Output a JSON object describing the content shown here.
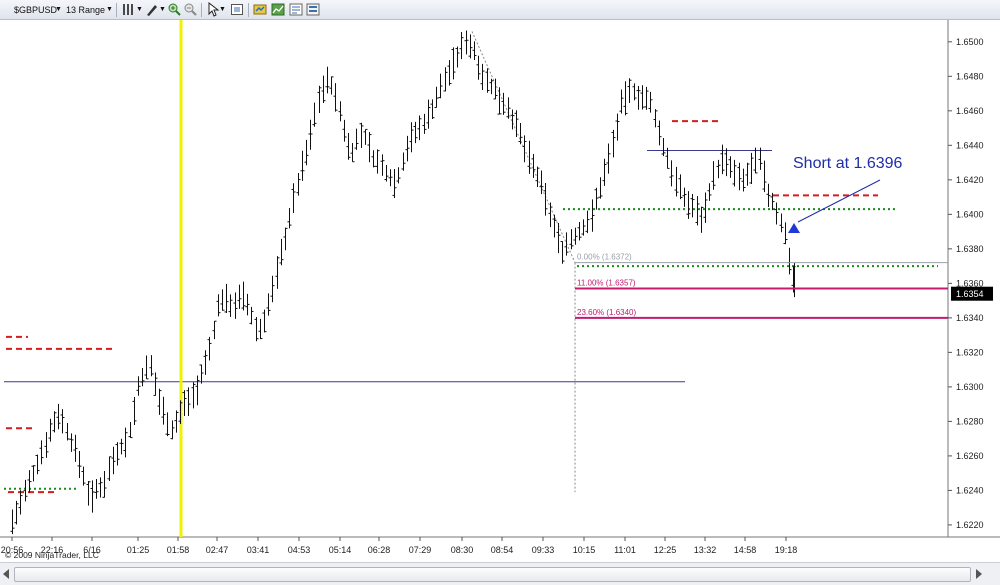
{
  "toolbar": {
    "instrument": "$GBPUSD",
    "period": "13 Range"
  },
  "copyright": "© 2009 NinjaTrader, LLC",
  "chart_data": {
    "type": "candlestick",
    "price_axis": {
      "ticks": [
        "1.6500",
        "1.6480",
        "1.6460",
        "1.6440",
        "1.6420",
        "1.6400",
        "1.6380",
        "1.6360",
        "1.6340",
        "1.6320",
        "1.6300",
        "1.6280",
        "1.6260",
        "1.6240",
        "1.6220"
      ],
      "min": 1.6213,
      "max": 1.6508,
      "current_price": "1.6354"
    },
    "time_axis": {
      "labels": [
        "20:56",
        "22:16",
        "6/16",
        "01:25",
        "01:58",
        "02:47",
        "03:41",
        "04:53",
        "05:14",
        "06:28",
        "07:29",
        "08:30",
        "08:54",
        "09:33",
        "10:15",
        "11:01",
        "12:25",
        "13:32",
        "14:58",
        "19:18"
      ]
    },
    "fib_levels": [
      {
        "label": "0.00% (1.6372)",
        "price": 1.6372,
        "color": "#9aa0a6"
      },
      {
        "label": "11.00% (1.6357)",
        "price": 1.6357,
        "color": "#c21b6f"
      },
      {
        "label": "23.60% (1.6340)",
        "price": 1.634,
        "color": "#c21b6f"
      }
    ],
    "annotation": {
      "text": "Short at 1.6396",
      "color": "#1f2ea8"
    },
    "colors": {
      "bars": "#111111",
      "vline": "#f2f200",
      "red_levels": "#d21e1e",
      "green_levels": "#1a8a1a",
      "blue_lines": "#3a3a8a",
      "arrow": "#1f39d6"
    }
  }
}
